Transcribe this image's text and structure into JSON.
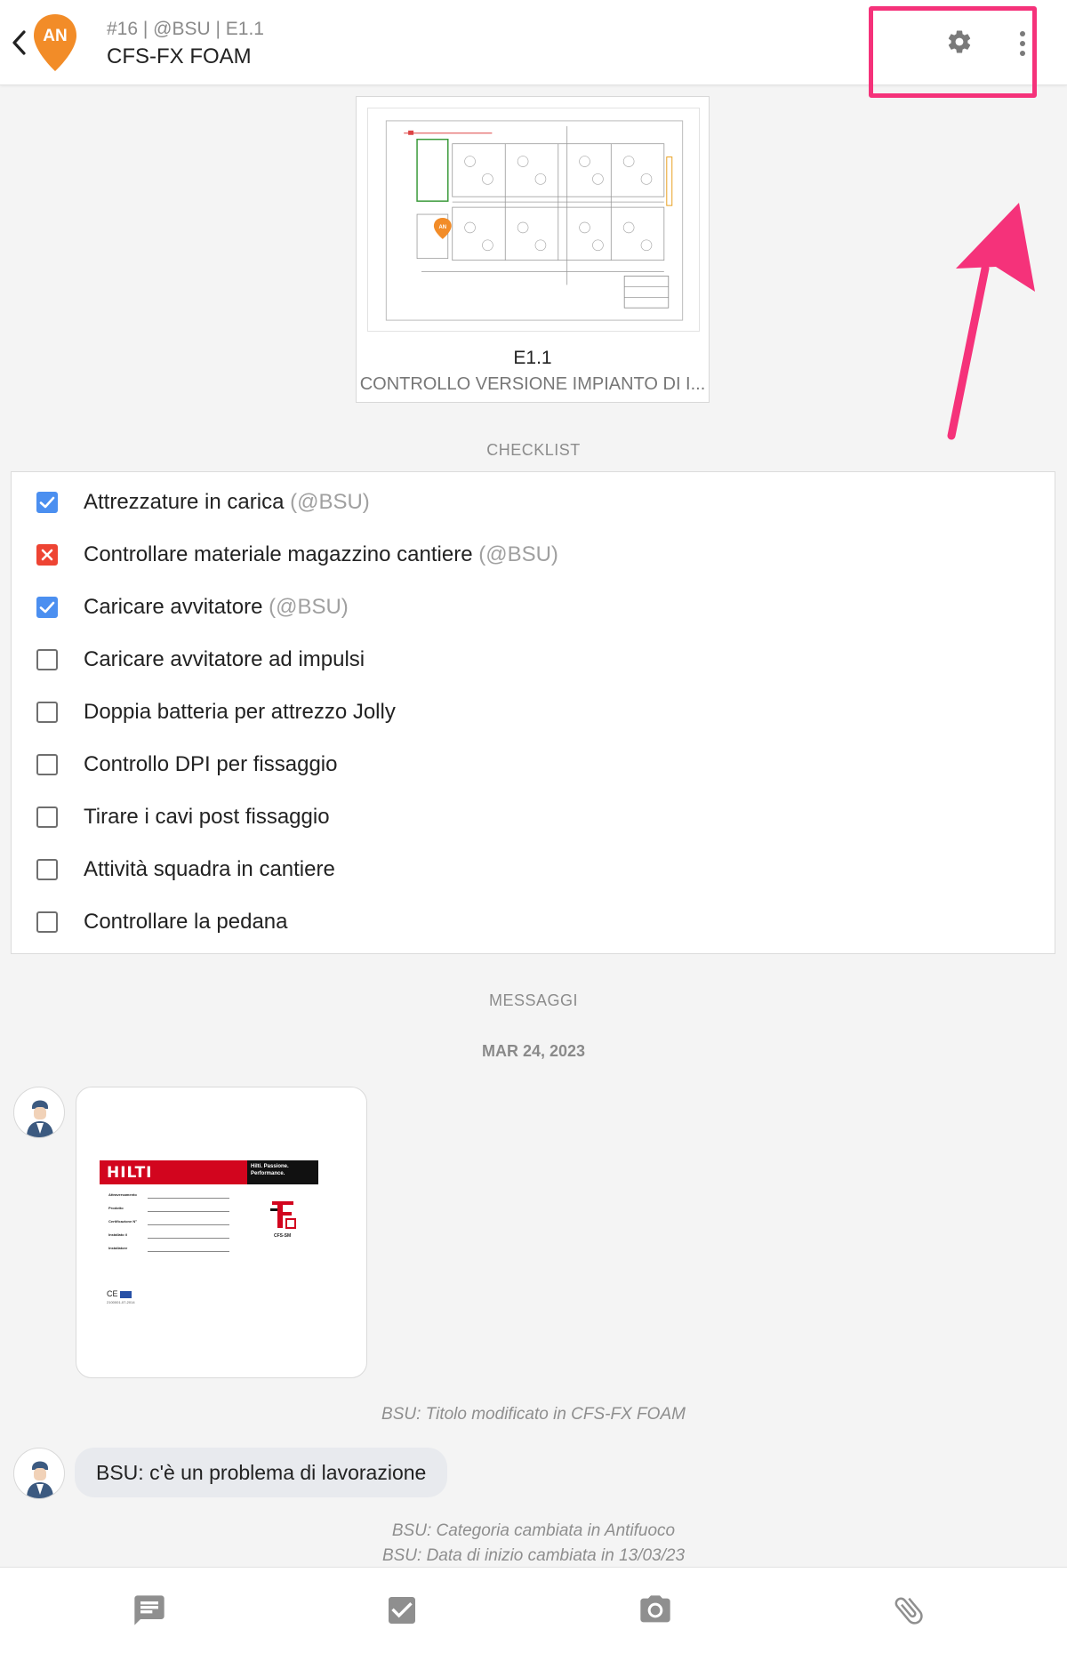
{
  "header": {
    "pin_initials": "AN",
    "meta": "#16 | @BSU | E1.1",
    "title": "CFS-FX FOAM",
    "pin_color": "#f28c28"
  },
  "drawing": {
    "code": "E1.1",
    "description": "CONTROLLO VERSIONE IMPIANTO DI I...",
    "pin_initials": "AN"
  },
  "sections": {
    "checklist": "CHECKLIST",
    "messages": "MESSAGGI"
  },
  "checklist": [
    {
      "text": "Attrezzature in carica",
      "user": "(@BSU)",
      "state": "checked"
    },
    {
      "text": "Controllare materiale magazzino cantiere",
      "user": "(@BSU)",
      "state": "failed"
    },
    {
      "text": "Caricare avvitatore",
      "user": "(@BSU)",
      "state": "checked"
    },
    {
      "text": "Caricare avvitatore ad impulsi",
      "user": "",
      "state": "unchecked"
    },
    {
      "text": "Doppia batteria per attrezzo Jolly",
      "user": "",
      "state": "unchecked"
    },
    {
      "text": "Controllo DPI per fissaggio",
      "user": "",
      "state": "unchecked"
    },
    {
      "text": "Tirare i cavi post fissaggio",
      "user": "",
      "state": "unchecked"
    },
    {
      "text": "Attività squadra in cantiere",
      "user": "",
      "state": "unchecked"
    },
    {
      "text": "Controllare la pedana",
      "user": "",
      "state": "unchecked"
    }
  ],
  "messages": {
    "date": "MAR 24, 2023",
    "hilti": {
      "brand": "HILTI",
      "tagline_1": "Hilti. Passione.",
      "tagline_2": "Performance.",
      "fields": [
        "Attraversamento",
        "Prodotto",
        "Certificazione N°",
        "Installato il",
        "Installatore"
      ],
      "product_code": "CFS-SM",
      "doc_number": "2100001-07-2014"
    },
    "system_1": "BSU: Titolo modificato in CFS-FX FOAM",
    "chat": "BSU: c'è un problema di lavorazione",
    "system_2": "BSU: Categoria cambiata in Antifuoco",
    "system_3": "BSU: Data di inizio cambiata in 13/03/23"
  },
  "colors": {
    "accent": "#4b8ff0",
    "fail": "#ee4433",
    "highlight": "#f5327a",
    "hilti_red": "#d2051e"
  },
  "icons": {
    "back": "chevron-left-icon",
    "settings": "gear-icon",
    "more": "more-vertical-icon",
    "chat": "chat-icon",
    "checklist": "checkbox-icon",
    "camera": "camera-icon",
    "attach": "paperclip-icon"
  }
}
